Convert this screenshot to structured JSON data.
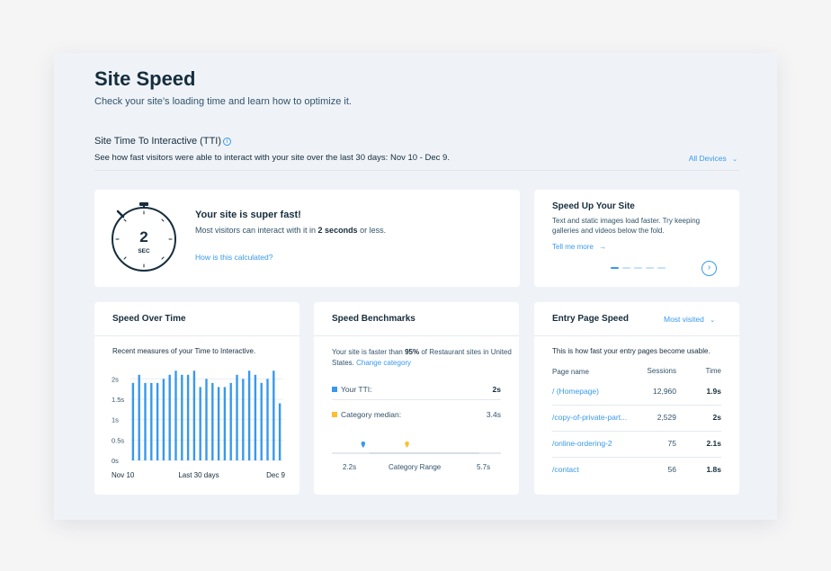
{
  "page": {
    "title": "Site Speed",
    "subtitle": "Check your site’s loading time and learn how to optimize it."
  },
  "tti": {
    "title": "Site Time To Interactive (TTI)",
    "info_icon": "info-icon",
    "description": "See how fast visitors were able to interact with your site over the last 30 days: Nov 10 - Dec 9.",
    "device_filter": "All Devices"
  },
  "summary": {
    "value": "2",
    "unit": "SEC",
    "headline": "Your site is super fast!",
    "desc_before": "Most visitors can interact with it in ",
    "desc_bold": "2 seconds",
    "desc_after": " or less.",
    "link": "How is this calculated?"
  },
  "tip": {
    "title": "Speed Up Your Site",
    "text": "Text and static images load faster. Try keeping galleries and videos below the fold.",
    "link": "Tell me more",
    "slides_total": 5,
    "slide_active": 1
  },
  "speed_over_time": {
    "title": "Speed Over Time",
    "description": "Recent measures of your Time to Interactive."
  },
  "chart_data": {
    "type": "bar",
    "ylim": [
      0,
      2.25
    ],
    "y_ticks": [
      "2s",
      "1.5s",
      "1s",
      "0.5s",
      "0s"
    ],
    "x_labels": [
      "Nov 10",
      "Last 30 days",
      "Dec 9"
    ],
    "values": [
      1.9,
      2.1,
      1.9,
      1.9,
      1.9,
      2.0,
      2.1,
      2.2,
      2.1,
      2.1,
      2.2,
      1.8,
      2.0,
      1.9,
      1.8,
      1.8,
      1.9,
      2.1,
      2.0,
      2.2,
      2.1,
      1.9,
      2.0,
      2.2,
      1.4
    ]
  },
  "benchmarks": {
    "title": "Speed Benchmarks",
    "desc_before": "Your site is faster than ",
    "desc_bold": "95%",
    "desc_after": " of Restaurant sites in United States. ",
    "desc_link": "Change category",
    "rows": [
      {
        "label": "Your TTI:",
        "value": "2s",
        "color": "#3899ec",
        "bold": true
      },
      {
        "label": "Category median:",
        "value": "3.4s",
        "color": "#fcbf2f",
        "bold": false
      }
    ],
    "range": {
      "min_label": "2.2s",
      "label": "Category Range",
      "max_label": "5.7s",
      "your_tti": 2.0,
      "median": 3.4,
      "min": 2.2,
      "max": 5.7
    }
  },
  "entry_pages": {
    "title": "Entry Page Speed",
    "filter": "Most visited",
    "description": "This is how fast your entry pages become usable.",
    "columns": [
      "Page name",
      "Sessions",
      "Time"
    ],
    "rows": [
      {
        "page": "/ (Homepage)",
        "sessions": "12,960",
        "time": "1.9s"
      },
      {
        "page": "/copy-of-private-part...",
        "sessions": "2,529",
        "time": "2s"
      },
      {
        "page": "/online-ordering-2",
        "sessions": "75",
        "time": "2.1s"
      },
      {
        "page": "/contact",
        "sessions": "56",
        "time": "1.8s"
      }
    ]
  },
  "colors": {
    "accent": "#3899ec",
    "median": "#fcbf2f",
    "heading": "#162d3d"
  }
}
